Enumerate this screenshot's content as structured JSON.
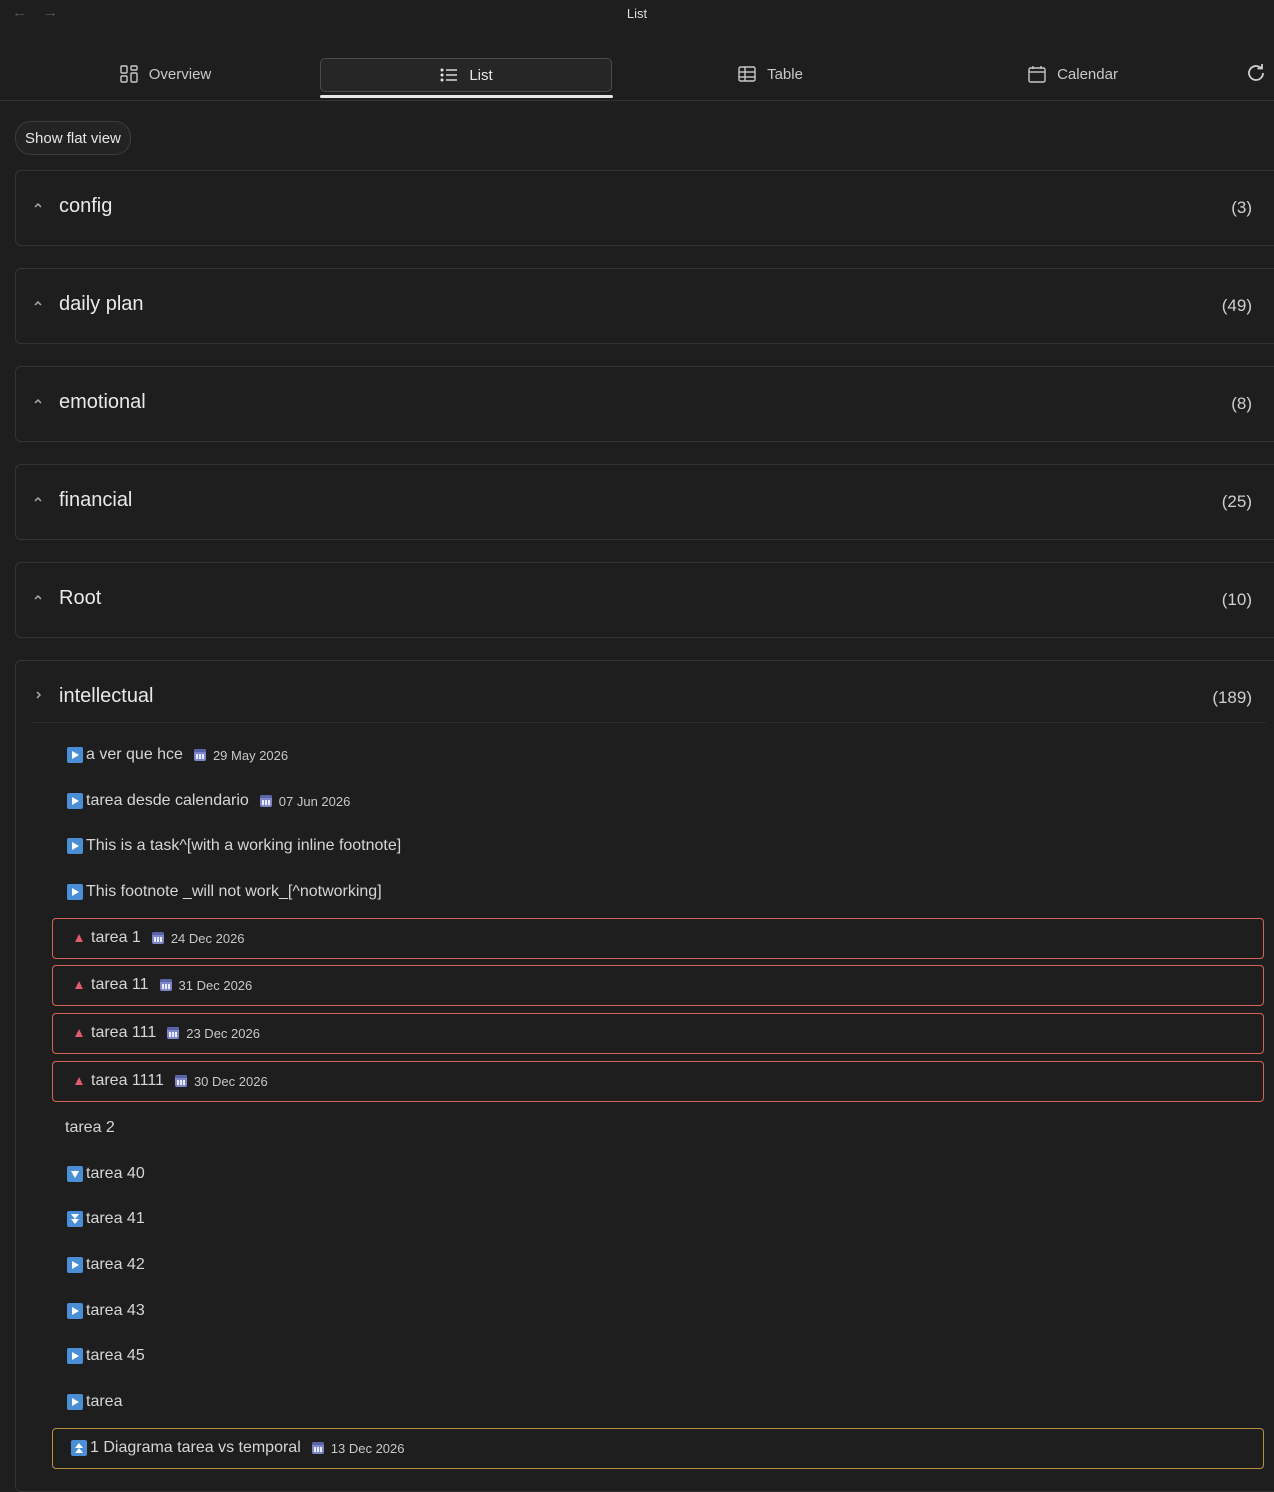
{
  "window": {
    "title": "List",
    "back_arrow": "←",
    "forward_arrow": "→"
  },
  "tabs": [
    {
      "label": "Overview",
      "icon": "grid-icon"
    },
    {
      "label": "List",
      "icon": "list-icon",
      "active": true
    },
    {
      "label": "Table",
      "icon": "table-icon"
    },
    {
      "label": "Calendar",
      "icon": "calendar-icon"
    }
  ],
  "toolbar": {
    "flat_view_label": "Show flat view",
    "refresh_icon": "refresh-icon"
  },
  "groups": [
    {
      "name": "config",
      "count": "(3)"
    },
    {
      "name": "daily plan",
      "count": "(49)"
    },
    {
      "name": "emotional",
      "count": "(8)"
    },
    {
      "name": "financial",
      "count": "(25)"
    },
    {
      "name": "Root",
      "count": "(10)"
    },
    {
      "name": "intellectual",
      "count": "(189)"
    }
  ],
  "tasks": [
    {
      "text": "a ver que hce",
      "date": "29 May 2026",
      "icon": "play-icon"
    },
    {
      "text": "tarea desde calendario",
      "date": "07 Jun 2026",
      "icon": "play-icon"
    },
    {
      "text": "This is a task^[with a working inline footnote]",
      "icon": "play-icon"
    },
    {
      "text": "This footnote _will not work_[^notworking]",
      "icon": "play-icon"
    },
    {
      "text": "tarea 1",
      "date": "24 Dec 2026",
      "icon": "high-priority-icon"
    },
    {
      "text": "tarea 11",
      "date": "31 Dec 2026",
      "icon": "high-priority-icon"
    },
    {
      "text": "tarea 111",
      "date": "23 Dec 2026",
      "icon": "high-priority-icon"
    },
    {
      "text": "tarea 1111",
      "date": "30 Dec 2026",
      "icon": "high-priority-icon"
    },
    {
      "text": "tarea 2"
    },
    {
      "text": "tarea 40",
      "icon": "down-triangle-icon"
    },
    {
      "text": "tarea 41",
      "icon": "double-down-icon"
    },
    {
      "text": "tarea 42",
      "icon": "play-icon"
    },
    {
      "text": "tarea 43",
      "icon": "play-icon"
    },
    {
      "text": "tarea 45",
      "icon": "play-icon"
    },
    {
      "text": "tarea",
      "icon": "play-icon"
    },
    {
      "text": "1 Diagrama tarea vs temporal",
      "date": "13 Dec 2026",
      "icon": "double-up-icon"
    }
  ],
  "colors": {
    "accent_red": "#d4655a",
    "accent_gold": "#b8913c",
    "icon_blue": "#4a8fd6"
  }
}
